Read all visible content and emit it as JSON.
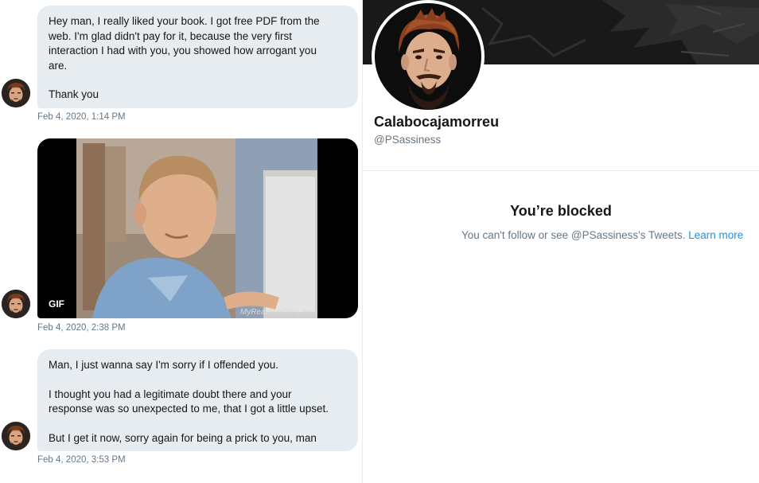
{
  "conversation": {
    "messages": [
      {
        "lines": [
          "Hey man, I really liked your book. I got free PDF from the",
          "web. I'm glad didn't pay for it, because the very first",
          "interaction I had with you, you showed how arrogant you",
          "are.",
          "",
          "Thank you"
        ],
        "timestamp": "Feb 4, 2020, 1:14 PM"
      },
      {
        "media_badge": "GIF",
        "watermark": "MyReactionGIFs.com",
        "timestamp": "Feb 4, 2020, 2:38 PM"
      },
      {
        "lines": [
          "Man, I just wanna say I'm sorry if I offended you.",
          "",
          "I thought you had a legitimate doubt there and your",
          "response was so unexpected to me, that I got a little upset.",
          "",
          "But I get it now, sorry again for being a prick to you, man"
        ],
        "timestamp": "Feb 4, 2020, 3:53 PM"
      }
    ]
  },
  "profile": {
    "display_name": "Calabocajamorreu",
    "handle": "@PSassiness",
    "blocked": {
      "title": "You’re blocked",
      "message": "You can't follow or see @PSassiness's Tweets. ",
      "link_label": "Learn more"
    }
  },
  "colors": {
    "bubble_bg": "#e6ecf0",
    "secondary_text": "#657786",
    "link": "#1b95e0",
    "divider": "#e6ecf0"
  },
  "icons": {
    "avatar": "cartoon-bearded-man-avatar"
  }
}
